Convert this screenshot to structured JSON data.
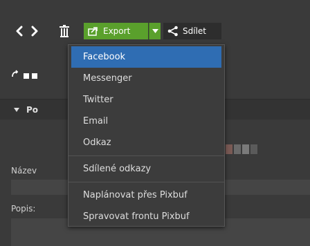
{
  "toolbar": {
    "export_label": "Export",
    "share_label": "Sdílet"
  },
  "menu": {
    "group1": [
      {
        "label": "Facebook",
        "active": true
      },
      {
        "label": "Messenger"
      },
      {
        "label": "Twitter"
      },
      {
        "label": "Email"
      },
      {
        "label": "Odkaz"
      }
    ],
    "group2": [
      {
        "label": "Sdílené odkazy"
      }
    ],
    "group3": [
      {
        "label": "Naplánovat přes Pixbuf"
      },
      {
        "label": "Spravovat frontu Pixbuf"
      }
    ]
  },
  "panel": {
    "section_title": "Po",
    "name_label": "Název",
    "desc_label": "Popis:"
  },
  "colors": {
    "accent_green": "#5aa02c",
    "highlight_blue": "#2f6db3"
  }
}
